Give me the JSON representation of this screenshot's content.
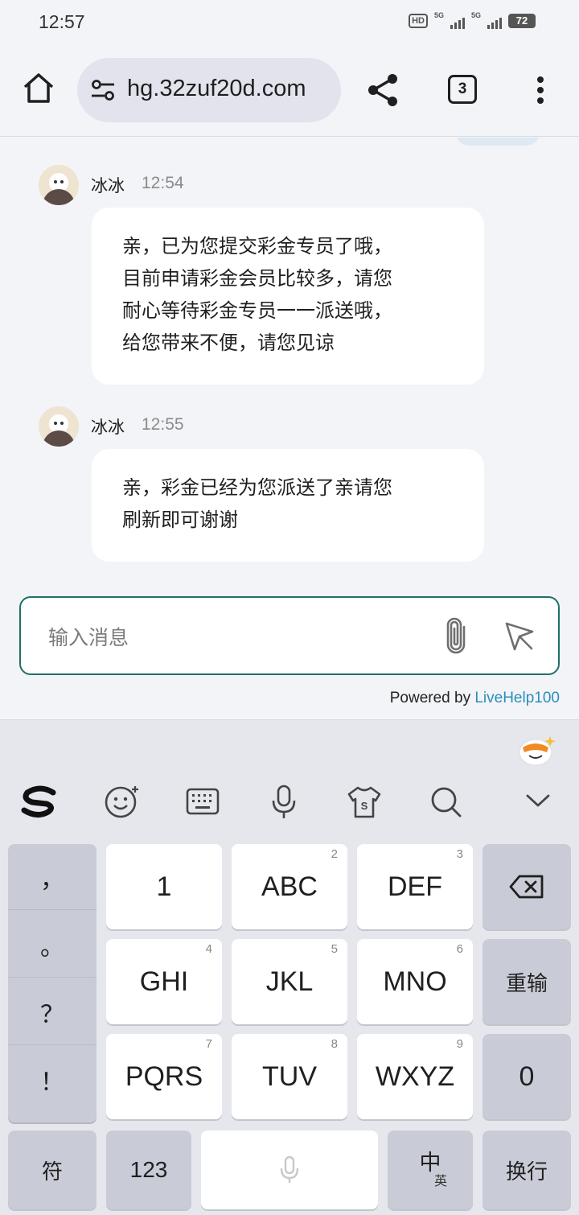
{
  "status_bar": {
    "time": "12:57",
    "hd": "HD",
    "net1": "5G",
    "net2": "5G",
    "battery": "72"
  },
  "browser": {
    "url": "hg.32zuf20d.com",
    "tab_count": "3"
  },
  "chat": {
    "messages": [
      {
        "sender": "冰冰",
        "time": "12:54",
        "text": "亲，已为您提交彩金专员了哦，\n目前申请彩金会员比较多，请您\n耐心等待彩金专员一一派送哦，\n给您带来不便，请您见谅"
      },
      {
        "sender": "冰冰",
        "time": "12:55",
        "text": "亲，彩金已经为您派送了亲请您\n刷新即可谢谢"
      }
    ],
    "input_placeholder": "输入消息",
    "powered_prefix": "Powered by ",
    "powered_brand": "LiveHelp100"
  },
  "keyboard": {
    "punctuation": [
      "，",
      "。",
      "？",
      "！"
    ],
    "rows": [
      [
        {
          "label": "1",
          "num": ""
        },
        {
          "label": "ABC",
          "num": "2"
        },
        {
          "label": "DEF",
          "num": "3"
        }
      ],
      [
        {
          "label": "GHI",
          "num": "4"
        },
        {
          "label": "JKL",
          "num": "5"
        },
        {
          "label": "MNO",
          "num": "6"
        }
      ],
      [
        {
          "label": "PQRS",
          "num": "7"
        },
        {
          "label": "TUV",
          "num": "8"
        },
        {
          "label": "WXYZ",
          "num": "9"
        }
      ]
    ],
    "reinput": "重输",
    "zero": "0",
    "symbols": "符",
    "numbers": "123",
    "lang_zh": "中",
    "lang_en": "英",
    "enter": "换行"
  }
}
